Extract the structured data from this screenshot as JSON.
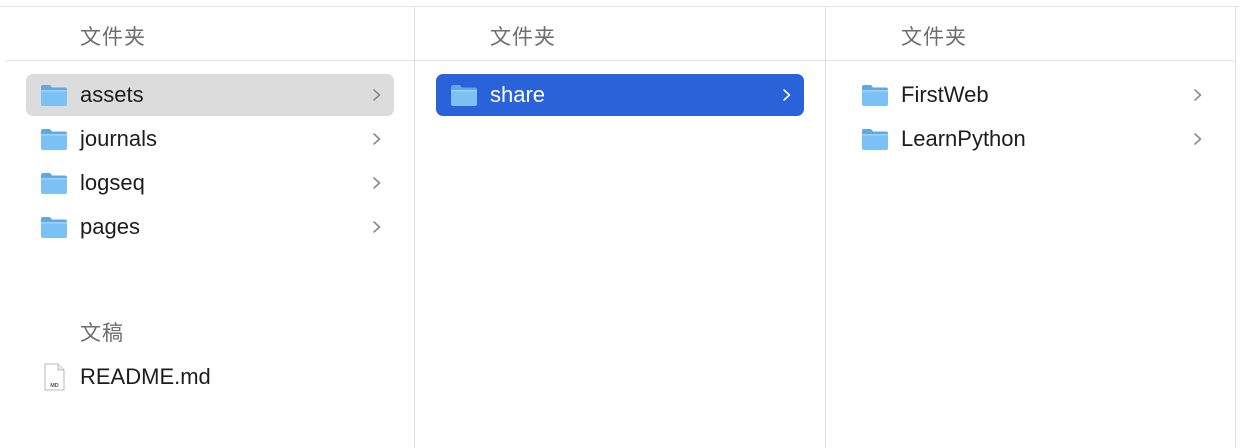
{
  "columns": [
    {
      "header": "文件夹",
      "items": [
        {
          "name": "assets",
          "state": "selected-inactive",
          "has_children": true
        },
        {
          "name": "journals",
          "state": "normal",
          "has_children": true
        },
        {
          "name": "logseq",
          "state": "normal",
          "has_children": true
        },
        {
          "name": "pages",
          "state": "normal",
          "has_children": true
        }
      ],
      "documents_header": "文稿",
      "documents": [
        {
          "name": "README.md",
          "badge": "MD"
        }
      ]
    },
    {
      "header": "文件夹",
      "items": [
        {
          "name": "share",
          "state": "selected-active",
          "has_children": true
        }
      ]
    },
    {
      "header": "文件夹",
      "items": [
        {
          "name": "FirstWeb",
          "state": "normal",
          "has_children": true
        },
        {
          "name": "LearnPython",
          "state": "normal",
          "has_children": true
        }
      ]
    }
  ],
  "colors": {
    "selection_active": "#2962d9",
    "selection_inactive": "#dcdcdc",
    "folder_blue": "#7cc1f5",
    "header_text": "#6e6e6e"
  },
  "icons": {
    "folder": "folder-icon",
    "document": "markdown-file-icon",
    "chevron": "chevron-right-icon"
  }
}
